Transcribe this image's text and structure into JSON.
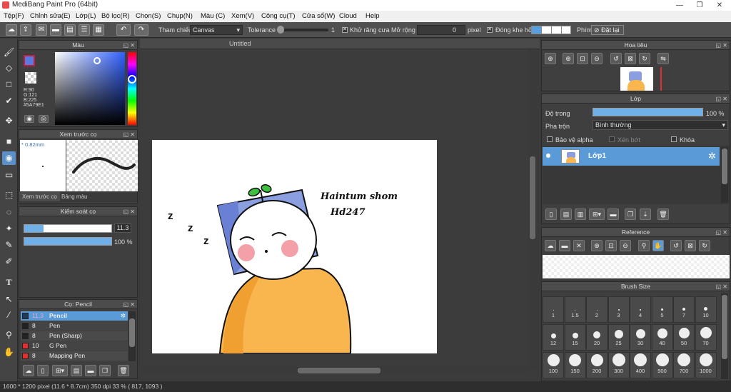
{
  "title": "MediBang Paint Pro (64bit)",
  "window_controls": [
    "—",
    "❐",
    "✕"
  ],
  "menu": [
    "Tệp(F)",
    "Chỉnh sửa(E)",
    "Lớp(L)",
    "Bộ lọc(R)",
    "Chọn(S)",
    "Chụp(N)",
    "Màu (C)",
    "Xem(V)",
    "Công cụ(T)",
    "Cửa sổ(W)",
    "Cloud",
    "Help"
  ],
  "toolbar": {
    "reference_label": "Tham chiếu",
    "reference_value": "Canvas",
    "tolerance_label": "Tolerance",
    "tolerance_value": "1",
    "antialias_label": "Khử răng cưa",
    "expand_label": "Mở rộng",
    "expand_value": "0",
    "expand_unit": "pixel",
    "gap_label": "Đóng khe hở",
    "hotkey_label": "Phím",
    "reset_label": "Đặt lại"
  },
  "color_panel": {
    "title": "Màu",
    "r": "R:90",
    "g": "G:121",
    "b": "B:225",
    "hex": "#5A79E1",
    "fg_color": "#5A79E1",
    "bg_color": "#ffffff"
  },
  "brush_preview": {
    "title": "Xem trước cọ",
    "size": "0.82mm",
    "tab1": "Xem trước cọ",
    "tab2": "Bảng màu"
  },
  "brush_control": {
    "title": "Kiểm soát cọ",
    "size_value": "11.3",
    "opacity_value": "100 %",
    "size_fraction": 0.22,
    "opacity_fraction": 1.0
  },
  "brush_list": {
    "title": "Cọ: Pencil",
    "items": [
      {
        "size": "11.3",
        "name": "Pencil",
        "color": "#1e3a5a",
        "selected": true
      },
      {
        "size": "8",
        "name": "Pen",
        "color": "#222222",
        "selected": false
      },
      {
        "size": "8",
        "name": "Pen (Sharp)",
        "color": "#222222",
        "selected": false
      },
      {
        "size": "10",
        "name": "G Pen",
        "color": "#e03030",
        "selected": false
      },
      {
        "size": "8",
        "name": "Mapping Pen",
        "color": "#e03030",
        "selected": false
      }
    ]
  },
  "canvas": {
    "tab_title": "Untitled",
    "text_line1": "Haintum shom",
    "text_line2": "Hd247",
    "z1": "z",
    "z2": "z",
    "z3": "z"
  },
  "navigator": {
    "title": "Hoa tiêu"
  },
  "layer_panel": {
    "title": "Lớp",
    "opacity_label": "Độ trong",
    "opacity_value": "100 %",
    "opacity_fraction": 1.0,
    "blend_label": "Pha trộn",
    "blend_value": "Bình thường",
    "protect_alpha": "Bảo vệ alpha",
    "clipping": "Xén bớt",
    "lock": "Khóa",
    "layer_name": "Lớp1"
  },
  "reference_panel": {
    "title": "Reference"
  },
  "brush_size_panel": {
    "title": "Brush Size",
    "sizes": [
      "1",
      "1.5",
      "2",
      "3",
      "4",
      "5",
      "7",
      "10",
      "12",
      "15",
      "20",
      "25",
      "30",
      "40",
      "50",
      "70",
      "100",
      "150",
      "200",
      "300",
      "400",
      "500",
      "700",
      "1000"
    ]
  },
  "status": {
    "dimensions": "1600 * 1200 pixel",
    "physical": "(11.6 * 8.7cm)",
    "dpi": "350 dpi",
    "zoom": "33 %",
    "cursor": "( 817, 1093 )"
  }
}
